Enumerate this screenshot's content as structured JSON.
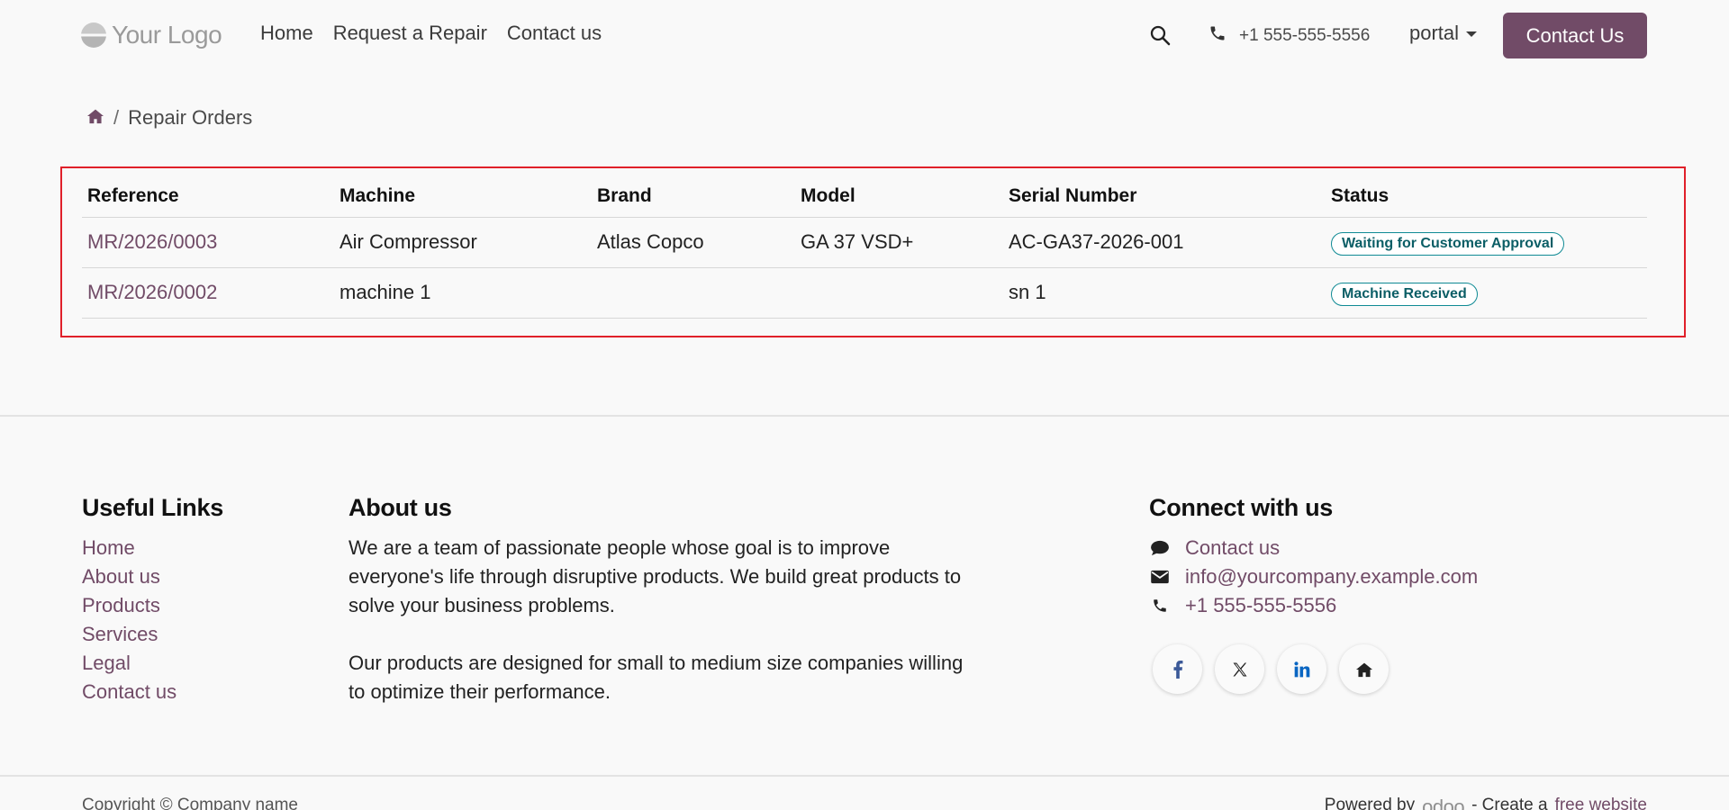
{
  "header": {
    "logo_text": "Your Logo",
    "nav": [
      {
        "label": "Home"
      },
      {
        "label": "Request a Repair"
      },
      {
        "label": "Contact us"
      }
    ],
    "phone": "+1 555-555-5556",
    "user": "portal",
    "cta_label": "Contact Us"
  },
  "breadcrumb": {
    "current": "Repair Orders"
  },
  "table": {
    "columns": [
      "Reference",
      "Machine",
      "Brand",
      "Model",
      "Serial Number",
      "Status"
    ],
    "rows": [
      {
        "reference": "MR/2026/0003",
        "machine": "Air Compressor",
        "brand": "Atlas Copco",
        "model": "GA 37 VSD+",
        "serial": "AC-GA37-2026-001",
        "status": "Waiting for Customer Approval"
      },
      {
        "reference": "MR/2026/0002",
        "machine": "machine 1",
        "brand": "",
        "model": "",
        "serial": "sn 1",
        "status": "Machine Received"
      }
    ]
  },
  "footer": {
    "useful_links": {
      "title": "Useful Links",
      "items": [
        "Home",
        "About us",
        "Products",
        "Services",
        "Legal",
        "Contact us"
      ]
    },
    "about": {
      "title": "About us",
      "paragraphs": [
        "We are a team of passionate people whose goal is to improve everyone's life through disruptive products. We build great products to solve your business problems.",
        "Our products are designed for small to medium size companies willing to optimize their performance."
      ]
    },
    "connect": {
      "title": "Connect with us",
      "contact": "Contact us",
      "email": "info@yourcompany.example.com",
      "phone": "+1 555-555-5556"
    },
    "copyright": "Copyright © Company name",
    "powered_by": "Powered by",
    "odoo": "odoo",
    "create_prefix": "- Create a",
    "create_link": "free website"
  },
  "colors": {
    "brand": "#714b67",
    "badge": "#0f8a94",
    "highlight": "#e0202a"
  }
}
